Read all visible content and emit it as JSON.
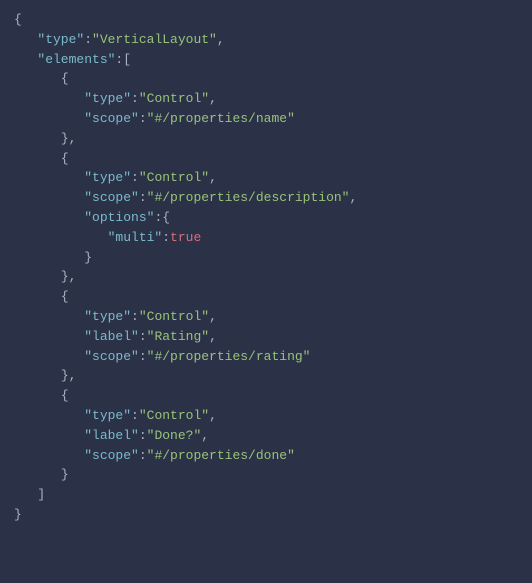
{
  "lines": [
    [
      [
        0,
        "p",
        "{"
      ]
    ],
    [
      [
        1,
        "k",
        "\"type\""
      ],
      [
        0,
        "p",
        ":"
      ],
      [
        0,
        "s",
        "\"VerticalLayout\""
      ],
      [
        0,
        "p",
        ","
      ]
    ],
    [
      [
        1,
        "k",
        "\"elements\""
      ],
      [
        0,
        "p",
        ":["
      ]
    ],
    [
      [
        2,
        "p",
        "{"
      ]
    ],
    [
      [
        3,
        "k",
        "\"type\""
      ],
      [
        0,
        "p",
        ":"
      ],
      [
        0,
        "s",
        "\"Control\""
      ],
      [
        0,
        "p",
        ","
      ]
    ],
    [
      [
        3,
        "k",
        "\"scope\""
      ],
      [
        0,
        "p",
        ":"
      ],
      [
        0,
        "s",
        "\"#/properties/name\""
      ]
    ],
    [
      [
        2,
        "p",
        "},"
      ]
    ],
    [
      [
        2,
        "p",
        "{"
      ]
    ],
    [
      [
        3,
        "k",
        "\"type\""
      ],
      [
        0,
        "p",
        ":"
      ],
      [
        0,
        "s",
        "\"Control\""
      ],
      [
        0,
        "p",
        ","
      ]
    ],
    [
      [
        3,
        "k",
        "\"scope\""
      ],
      [
        0,
        "p",
        ":"
      ],
      [
        0,
        "s",
        "\"#/properties/description\""
      ],
      [
        0,
        "p",
        ","
      ]
    ],
    [
      [
        3,
        "k",
        "\"options\""
      ],
      [
        0,
        "p",
        ":{"
      ]
    ],
    [
      [
        4,
        "k",
        "\"multi\""
      ],
      [
        0,
        "p",
        ":"
      ],
      [
        0,
        "b",
        "true"
      ]
    ],
    [
      [
        3,
        "p",
        "}"
      ]
    ],
    [
      [
        2,
        "p",
        "},"
      ]
    ],
    [
      [
        2,
        "p",
        "{"
      ]
    ],
    [
      [
        3,
        "k",
        "\"type\""
      ],
      [
        0,
        "p",
        ":"
      ],
      [
        0,
        "s",
        "\"Control\""
      ],
      [
        0,
        "p",
        ","
      ]
    ],
    [
      [
        3,
        "k",
        "\"label\""
      ],
      [
        0,
        "p",
        ":"
      ],
      [
        0,
        "s",
        "\"Rating\""
      ],
      [
        0,
        "p",
        ","
      ]
    ],
    [
      [
        3,
        "k",
        "\"scope\""
      ],
      [
        0,
        "p",
        ":"
      ],
      [
        0,
        "s",
        "\"#/properties/rating\""
      ]
    ],
    [
      [
        2,
        "p",
        "},"
      ]
    ],
    [
      [
        2,
        "p",
        "{"
      ]
    ],
    [
      [
        3,
        "k",
        "\"type\""
      ],
      [
        0,
        "p",
        ":"
      ],
      [
        0,
        "s",
        "\"Control\""
      ],
      [
        0,
        "p",
        ","
      ]
    ],
    [
      [
        3,
        "k",
        "\"label\""
      ],
      [
        0,
        "p",
        ":"
      ],
      [
        0,
        "s",
        "\"Done?\""
      ],
      [
        0,
        "p",
        ","
      ]
    ],
    [
      [
        3,
        "k",
        "\"scope\""
      ],
      [
        0,
        "p",
        ":"
      ],
      [
        0,
        "s",
        "\"#/properties/done\""
      ]
    ],
    [
      [
        2,
        "p",
        "}"
      ]
    ],
    [
      [
        1,
        "p",
        "]"
      ]
    ],
    [
      [
        0,
        "p",
        "}"
      ]
    ]
  ],
  "indent_unit": "   "
}
